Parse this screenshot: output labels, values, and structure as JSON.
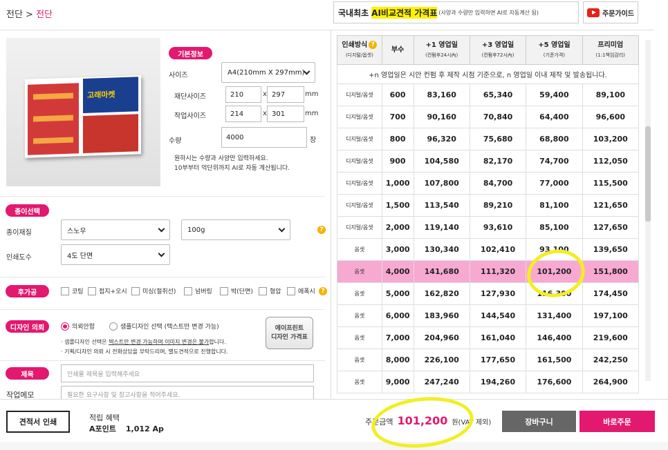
{
  "breadcrumb": {
    "root": "전단",
    "sep": " > ",
    "current": "전단"
  },
  "promo": {
    "lead": "국내최초",
    "highlight": "AI비교견적 가격표",
    "sub": "(사양과 수량만 입력하면 AI로 자동계산 됨)"
  },
  "guide": {
    "label": "주문가이드"
  },
  "basic": {
    "tag": "기본정보",
    "size_label": "사이즈",
    "size_value": "A4(210mm X 297mm)",
    "cut_label": "재단사이즈",
    "cut_w": "210",
    "cut_h": "297",
    "work_label": "작업사이즈",
    "work_w": "214",
    "work_h": "301",
    "x": "x",
    "unit_mm": "mm",
    "qty_label": "수량",
    "qty_value": "4000",
    "qty_unit": "장",
    "note1": "원하시는 수량과 사양만 입력하세요.",
    "note2": "10부부터 억단위까지 AI로 자동 계산됩니다."
  },
  "paper": {
    "tag": "종이선택",
    "material_label": "종이재질",
    "material_value": "스노우",
    "weight_value": "100g",
    "color_label": "인쇄도수",
    "color_value": "4도 단면"
  },
  "finishing": {
    "tag": "후가공",
    "options": [
      "코팅",
      "접지+오시",
      "미싱(절취선)",
      "넘버링",
      "박(단면)",
      "형압",
      "에폭시"
    ]
  },
  "design": {
    "tag": "디자인 의뢰",
    "opt1": "의뢰안함",
    "opt2": "샘플디자인 선택 (텍스트만 변경 가능)",
    "note1_pre": "· 샘플디자인 선택은 ",
    "note1_u1": "텍스트만 변경 가능하며 이미지 변경은 불가",
    "note1_post": "합니다.",
    "note2": "· 기획/디자인 의뢰 시 전화상담을 부탁드리며, 별도견적으로 진행합니다.",
    "eprint_line1": "에이프린트",
    "eprint_line2": "디자인 가격표"
  },
  "title_field": {
    "tag": "제목",
    "placeholder": "인쇄물 제목을 입력해주세요"
  },
  "memo_field": {
    "label": "작업메모",
    "placeholder": "필요한 요구사항 및 참고사항을 적어주세요."
  },
  "table": {
    "headers": [
      {
        "main": "인쇄방식",
        "sub": "(디지털/옵셋)"
      },
      {
        "main": "부수",
        "sub": ""
      },
      {
        "main": "+1 영업일",
        "sub": "(컨펌후24시內)"
      },
      {
        "main": "+3 영업일",
        "sub": "(컨펌후72시內)"
      },
      {
        "main": "+5 영업일",
        "sub": "(기준가격)"
      },
      {
        "main": "프리미엄",
        "sub": "(1:1책임감리)"
      }
    ],
    "note": "+n 영업일은 시안 컨펌 후 제작 시점 기준으로, n 영업일 이내 제작 및 발송됩니다.",
    "rows": [
      [
        "디지털/옵셋",
        "600",
        "83,160",
        "65,340",
        "59,400",
        "89,100"
      ],
      [
        "디지털/옵셋",
        "700",
        "90,160",
        "70,840",
        "64,400",
        "96,600"
      ],
      [
        "디지털/옵셋",
        "800",
        "96,320",
        "75,680",
        "68,800",
        "103,200"
      ],
      [
        "디지털/옵셋",
        "900",
        "104,580",
        "82,170",
        "74,700",
        "112,050"
      ],
      [
        "디지털/옵셋",
        "1,000",
        "107,800",
        "84,700",
        "77,000",
        "115,500"
      ],
      [
        "디지털/옵셋",
        "1,500",
        "113,540",
        "89,210",
        "81,100",
        "121,650"
      ],
      [
        "디지털/옵셋",
        "2,000",
        "119,140",
        "93,610",
        "85,100",
        "127,650"
      ],
      [
        "옵셋",
        "3,000",
        "130,340",
        "102,410",
        "93,100",
        "139,650"
      ],
      [
        "옵셋",
        "4,000",
        "141,680",
        "111,320",
        "101,200",
        "151,800"
      ],
      [
        "옵셋",
        "5,000",
        "162,820",
        "127,930",
        "116,300",
        "174,450"
      ],
      [
        "옵셋",
        "6,000",
        "183,960",
        "144,540",
        "131,400",
        "197,100"
      ],
      [
        "옵셋",
        "7,000",
        "204,960",
        "161,040",
        "146,400",
        "219,600"
      ],
      [
        "옵셋",
        "8,000",
        "226,100",
        "177,650",
        "161,500",
        "242,250"
      ],
      [
        "옵셋",
        "9,000",
        "247,240",
        "194,260",
        "176,600",
        "264,900"
      ]
    ],
    "highlight_index": 8
  },
  "footer": {
    "print_estimate": "견적서 인쇄",
    "points_label": "적립 혜택",
    "points_name": "A포인트",
    "points_value": "1,012 Ap",
    "total_label": "주문금액",
    "total_value": "101,200",
    "total_unit": "원(VAT 제외)",
    "cart": "장바구니",
    "order": "바로주문"
  },
  "colors": {
    "accent": "#e3186f",
    "highlight_row": "#f7a9d2",
    "marker": "#f2ee22"
  }
}
